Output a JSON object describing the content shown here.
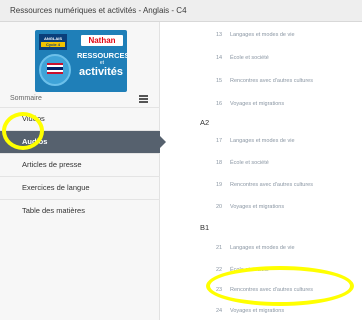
{
  "header": {
    "title": "Ressources numériques et activités - Anglais - C4"
  },
  "cover": {
    "tag_line1": "ANGLAIS",
    "tag_line2": "Cycle 4",
    "brand": "Nathan",
    "line1": "RESSOURCES",
    "line2": "et",
    "line3": "activités",
    "accent_color": "#1f7fb8"
  },
  "sidebar": {
    "summary_label": "Sommaire",
    "summary_icon": "list-icon",
    "items": [
      {
        "label": "Vidéos",
        "active": false
      },
      {
        "label": "Audios",
        "active": true
      },
      {
        "label": "Articles de presse",
        "active": false
      },
      {
        "label": "Exercices de langue",
        "active": false
      },
      {
        "label": "Table des matières",
        "active": false
      }
    ]
  },
  "content": {
    "rows_a1": [
      {
        "num": "13",
        "title": "Langages et modes de vie"
      },
      {
        "num": "14",
        "title": "École et société"
      },
      {
        "num": "15",
        "title": "Rencontres avec d'autres cultures"
      },
      {
        "num": "16",
        "title": "Voyages et migrations"
      }
    ],
    "section_a2": "A2",
    "rows_a2": [
      {
        "num": "17",
        "title": "Langages et modes de vie"
      },
      {
        "num": "18",
        "title": "École et société"
      },
      {
        "num": "19",
        "title": "Rencontres avec d'autres cultures"
      },
      {
        "num": "20",
        "title": "Voyages et migrations"
      }
    ],
    "section_b1": "B1",
    "rows_b1": [
      {
        "num": "21",
        "title": "Langages et modes de vie"
      },
      {
        "num": "22",
        "title": "École et société"
      },
      {
        "num": "23",
        "title": "Rencontres avec d'autres cultures"
      },
      {
        "num": "24",
        "title": "Voyages et migrations"
      }
    ]
  },
  "highlight_color": "#ffff00"
}
